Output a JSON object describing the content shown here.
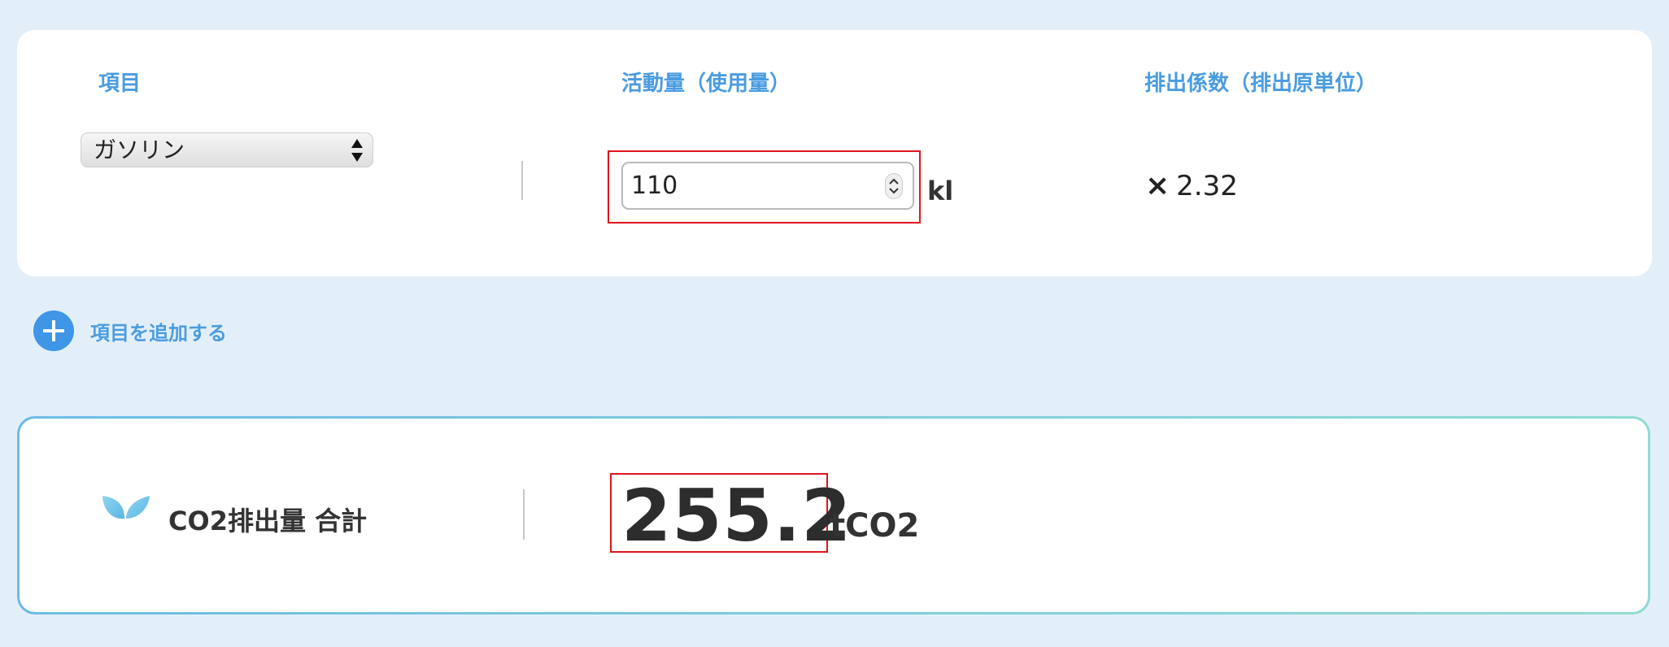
{
  "headers": {
    "item": "項目",
    "activity": "活動量（使用量）",
    "factor": "排出係数（排出原単位）"
  },
  "row": {
    "item_selected": "ガソリン",
    "activity_value": "110",
    "activity_unit": "kl",
    "factor_symbol": "×",
    "factor_value": "2.32"
  },
  "add_item_label": "項目を追加する",
  "total": {
    "label": "CO2排出量 合計",
    "value": "255.2",
    "unit": "tCO2"
  },
  "colors": {
    "accent": "#4a9ce0",
    "add_button": "#3f95e6",
    "highlight": "#e0141c",
    "background": "#e3eff8"
  },
  "icons": {
    "add": "plus-icon",
    "sprout": "sprout-icon",
    "select": "select-arrows-icon",
    "spinner": "spinner-icon"
  }
}
